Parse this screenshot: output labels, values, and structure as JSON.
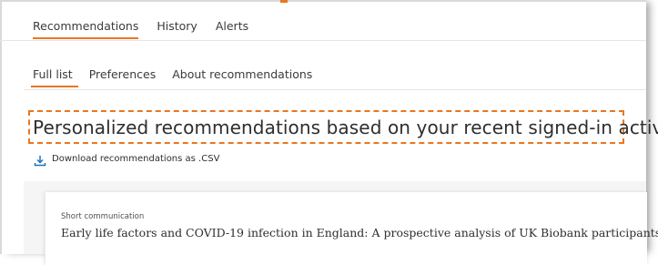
{
  "nav": {
    "primary_tabs": [
      {
        "label": "Recommendations",
        "active": true
      },
      {
        "label": "History",
        "active": false
      },
      {
        "label": "Alerts",
        "active": false
      }
    ],
    "secondary_tabs": [
      {
        "label": "Full list",
        "active": true
      },
      {
        "label": "Preferences",
        "active": false
      },
      {
        "label": "About recommendations",
        "active": false
      }
    ]
  },
  "main": {
    "title": "Personalized recommendations based on your recent signed-in activity",
    "download_label": "Download recommendations as .CSV"
  },
  "recommendations": [
    {
      "type": "Short communication",
      "title": "Early life factors and COVID-19 infection in England: A prospective analysis of UK Biobank participants"
    }
  ],
  "colors": {
    "accent": "#e87722",
    "link_icon": "#1f72b8",
    "text": "#2e2e2e"
  },
  "icons": {
    "download": "download-icon"
  }
}
